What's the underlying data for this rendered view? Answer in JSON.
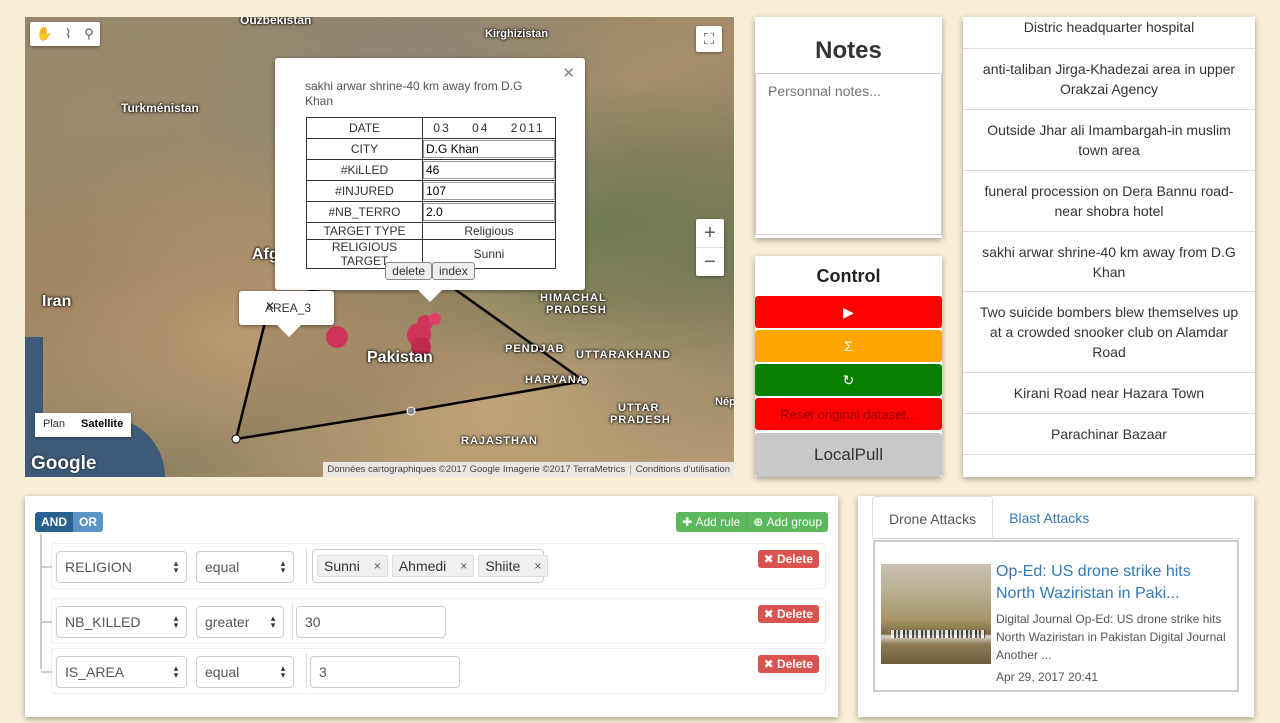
{
  "map": {
    "labels": {
      "uzbekistan": "Ouzbékistan",
      "kirghizistan": "Kirghizistan",
      "turkmenistan": "Turkménistan",
      "afghanistan_partial": "Afg",
      "iran": "Iran",
      "pakistan": "Pakistan",
      "himachal": "HIMACHAL",
      "pradesh1": "PRADESH",
      "punjab": "PENDJAB",
      "uttarakhand": "UTTARAKHAND",
      "haryana": "HARYANA",
      "uttar": "UTTAR",
      "pradesh2": "PRADESH",
      "rajasthan": "RAJASTHAN",
      "nepal_partial": "Nép"
    },
    "map_type": {
      "plan": "Plan",
      "satellite": "Satellite",
      "selected": "Satellite"
    },
    "logo": "Google",
    "attribution": "Données cartographiques ©2017 Google Imagerie ©2017 TerraMetrics",
    "terms": "Conditions d'utilisation",
    "zoom_in": "+",
    "zoom_out": "−",
    "marker_color": "#d0335a",
    "info_window": {
      "title": "sakhi arwar shrine-40 km away from D.G Khan",
      "rows": {
        "date_label": "DATE",
        "date_value": "03    04    2011",
        "city_label": "CITY",
        "city_value": "D.G Khan",
        "killed_label": "#KiLLED",
        "killed_value": "46",
        "injured_label": "#INJURED",
        "injured_value": "107",
        "nb_terro_label": "#NB_TERRO",
        "nb_terro_value": "2.0",
        "target_type_label": "TARGET TYPE",
        "target_type_value": "Religious",
        "religious_target_label": "RELIGIOUS TARGET",
        "religious_target_value": "Sunni"
      },
      "delete_label": "delete",
      "index_label": "index"
    },
    "area_window": {
      "label": "AREA_3"
    }
  },
  "notes": {
    "title": "Notes",
    "placeholder": "Personnal notes..."
  },
  "control": {
    "title": "Control",
    "play_icon": "▶",
    "sum_icon": "Σ",
    "refresh_icon": "↻",
    "reset_label": "Reset original dataset...",
    "localpull_label": "LocalPull",
    "colors": {
      "red": "#ff0000",
      "orange": "#ffa500",
      "green": "#0a8000",
      "grey": "#c8c8c8"
    }
  },
  "list": {
    "items": [
      "Distric headquarter hospital",
      "anti-taliban Jirga-Khadezai area in upper Orakzai Agency",
      "Outside Jhar ali Imambargah-in muslim town area",
      "funeral procession on Dera Bannu road-near shobra hotel",
      "sakhi arwar shrine-40 km away from D.G Khan",
      "Two suicide bombers blew themselves up at a crowded snooker club on Alamdar Road",
      "Kirani Road near Hazara Town",
      "Parachinar Bazaar"
    ]
  },
  "query_builder": {
    "and_label": "AND",
    "or_label": "OR",
    "add_rule_label": "Add rule",
    "add_group_label": "Add group",
    "delete_label": "Delete",
    "rules": [
      {
        "field": "RELIGION",
        "operator": "equal",
        "tags": [
          "Sunni",
          "Ahmedi",
          "Shiite"
        ]
      },
      {
        "field": "NB_KILLED",
        "operator": "greater",
        "value": "30"
      },
      {
        "field": "IS_AREA",
        "operator": "equal",
        "value": "3"
      }
    ]
  },
  "news": {
    "tabs": [
      "Drone Attacks",
      "Blast Attacks"
    ],
    "active_tab": "Drone Attacks",
    "article": {
      "title": "Op-Ed: US drone strike hits North Waziristan in Paki...",
      "description": "Digital Journal Op-Ed: US drone strike hits North Waziristan in Pakistan Digital Journal Another ...",
      "date": "Apr 29, 2017 20:41"
    }
  }
}
